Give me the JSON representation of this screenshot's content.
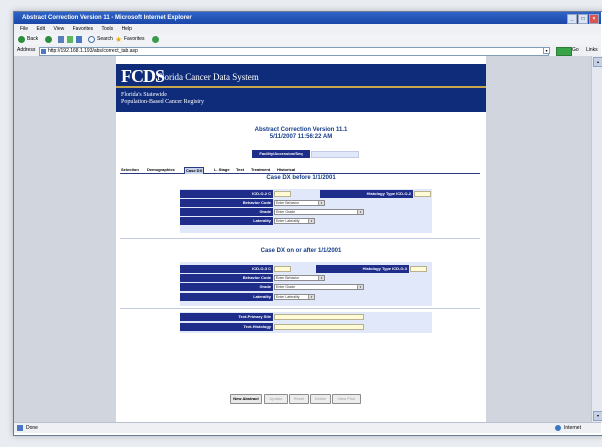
{
  "window": {
    "title": "Abstract Correction Version 11 - Microsoft Internet Explorer"
  },
  "menu": [
    "File",
    "Edit",
    "View",
    "Favorites",
    "Tools",
    "Help"
  ],
  "toolbar": {
    "back": "Back",
    "search": "Search",
    "favorites": "Favorites"
  },
  "address": {
    "label": "Address",
    "url": "http://192.168.1.193/abs/correct_tab.asp",
    "go": "Go",
    "links": "Links"
  },
  "banner": {
    "logo": "FCDS",
    "system_name": "Florida Cancer Data System",
    "line1": "Florida's Statewide",
    "line2": "Population-Based Cancer Registry"
  },
  "header": {
    "title": "Abstract Correction Version 11.1",
    "datetime": "5/11/2007 11:56:22 AM",
    "facility_label": "Facility/Accession/Seq"
  },
  "tabs": [
    "Selection",
    "Demographics",
    "Case DX",
    "L. Stage",
    "Text",
    "Treatment",
    "Historical"
  ],
  "active_tab": "Case DX",
  "section1": {
    "title": "Case DX before 1/1/2001",
    "icdo2_label": "ICD-O-2 C",
    "hist_label": "Histology Type ICD-O-2",
    "behavior_label": "Behavior Code",
    "behavior_value": "Enter Behavior",
    "grade_label": "Grade",
    "grade_value": "Enter Grade",
    "laterality_label": "Laterality",
    "laterality_value": "Enter Laterality"
  },
  "section2": {
    "title": "Case DX on or after 1/1/2001",
    "icdo3_label": "ICD-O-3 C",
    "hist_label": "Histology Type ICD-O-3",
    "behavior_label": "Behavior Code",
    "behavior_value": "Enter Behavior",
    "grade_label": "Grade",
    "grade_value": "Enter Grade",
    "laterality_label": "Laterality",
    "laterality_value": "Enter Laterality"
  },
  "section3": {
    "primary_label": "Text-Primary Site",
    "histology_label": "Text-Histology"
  },
  "buttons": [
    "New Abstract",
    "Update",
    "Reset",
    "Delete",
    "View Prior"
  ],
  "status": {
    "left": "Done",
    "zone": "Internet"
  }
}
